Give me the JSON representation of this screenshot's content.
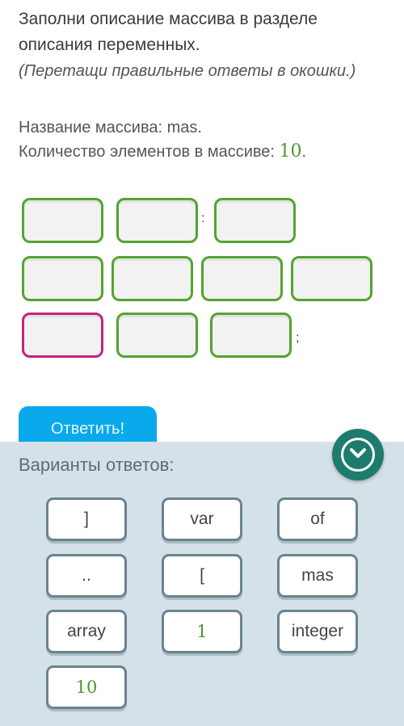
{
  "question": {
    "title": "Заполни описание массива в разделе описания переменных.",
    "hint": "(Перетащи правильные ответы в окошки.)",
    "name_label": "Название массива: mas.",
    "count_label": "Количество элементов в массиве: ",
    "count_value": "10",
    "count_suffix": "."
  },
  "slots": {
    "colon": ":",
    "semicolon": ";",
    "rows": [
      {
        "count": 3,
        "highlighted_index": null
      },
      {
        "count": 4,
        "highlighted_index": null
      },
      {
        "count": 3,
        "highlighted_index": 0
      }
    ]
  },
  "colors": {
    "slot_border": "#55a32f",
    "slot_highlight": "#c2237e",
    "answer_button": "#0aa9ec",
    "panel_bg": "#d5e1e8",
    "toggle": "#1d7c6d"
  },
  "answer_button": "Ответить!",
  "options_panel": {
    "title": "Варианты ответов:",
    "toggle_icon": "chevron-down-circle",
    "options": [
      "]",
      "var",
      "of",
      "..",
      "[",
      "mas",
      "array",
      "1",
      "integer",
      "10"
    ]
  }
}
